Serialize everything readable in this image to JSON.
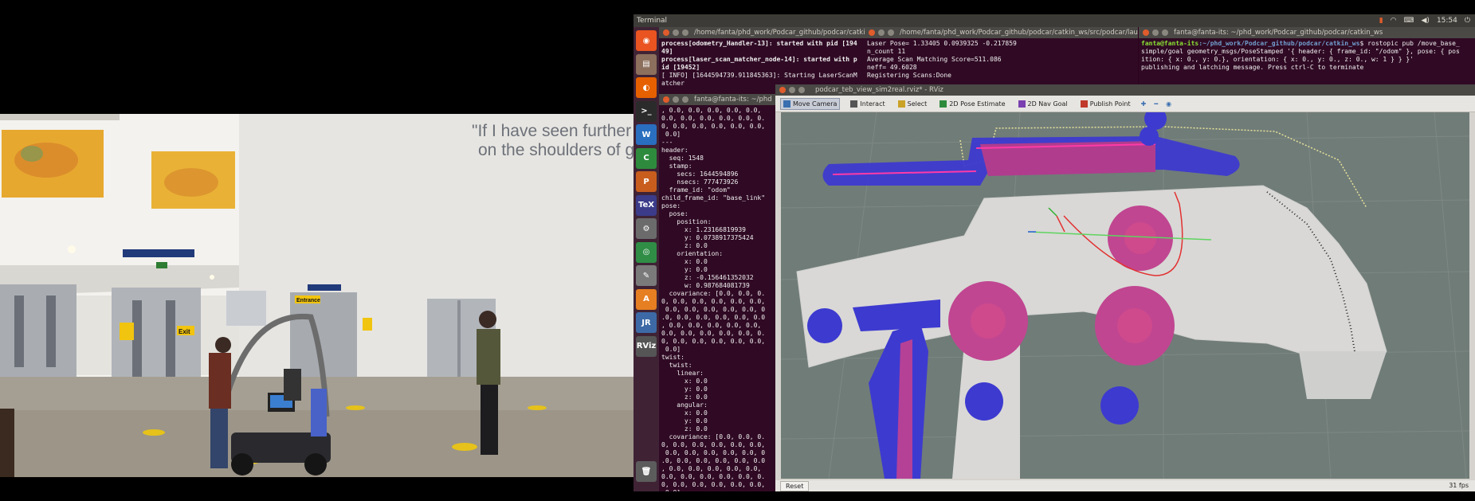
{
  "desktop": {
    "topbar_title": "Terminal",
    "clock": "15:54",
    "launcher": [
      {
        "name": "ubuntu-dash-icon",
        "glyph": "◉",
        "color": "#e95420"
      },
      {
        "name": "files-icon",
        "glyph": "▤",
        "color": "#8c6f5c"
      },
      {
        "name": "firefox-icon",
        "glyph": "◐",
        "color": "#e66000"
      },
      {
        "name": "terminal-icon",
        "glyph": ">_",
        "color": "#2b2b2b"
      },
      {
        "name": "writer-icon",
        "glyph": "W",
        "color": "#2a6ebf"
      },
      {
        "name": "calc-icon",
        "glyph": "C",
        "color": "#2e8b3d"
      },
      {
        "name": "impress-icon",
        "glyph": "P",
        "color": "#c85d1e"
      },
      {
        "name": "texmaker-icon",
        "glyph": "TeX",
        "color": "#3b3b8a"
      },
      {
        "name": "settings-icon",
        "glyph": "⚙",
        "color": "#6b6b6b"
      },
      {
        "name": "chrome-icon",
        "glyph": "◎",
        "color": "#2f8d46"
      },
      {
        "name": "editor-icon",
        "glyph": "✎",
        "color": "#7a7a7a"
      },
      {
        "name": "software-center-icon",
        "glyph": "A",
        "color": "#e67e22"
      },
      {
        "name": "jabref-icon",
        "glyph": "JR",
        "color": "#3d6aa6"
      },
      {
        "name": "rviz-icon",
        "glyph": "RViz",
        "color": "#555555"
      },
      {
        "name": "trash-icon",
        "glyph": "🗑",
        "color": "#5c5c5c"
      }
    ]
  },
  "terminals": {
    "t1": {
      "title": "/home/fanta/phd_work/Podcar_github/podcar/catkin_",
      "lines": [
        {
          "text": "process[odometry_Handler-13]: started with pid [194",
          "cls": "bold"
        },
        {
          "text": "49]",
          "cls": "bold"
        },
        {
          "text": "process[laser_scan_matcher_node-14]: started with p",
          "cls": "bold"
        },
        {
          "text": "id [19452]",
          "cls": "bold"
        },
        {
          "text": "[ INFO] [1644594739.911845363]: Starting LaserScanM",
          "cls": ""
        },
        {
          "text": "atcher",
          "cls": ""
        }
      ]
    },
    "t2": {
      "title": "/home/fanta/phd_work/Podcar_github/podcar/catkin_ws/src/podcar/laun",
      "lines": [
        "Laser Pose= 1.33405 0.0939325 -0.217859",
        "n_count 11",
        "Average Scan Matching Score=511.086",
        "neff= 49.6028",
        "Registering Scans:Done"
      ]
    },
    "t3": {
      "title": "fanta@fanta-its: ~/phd_work/Podcar_github/podcar/catkin_ws",
      "prompt_user": "fanta@fanta-its",
      "prompt_path": ":~/phd_work/Podcar_github/podcar/catkin_ws",
      "lines": [
        "$ rostopic pub /move_base_",
        "simple/goal geometry_msgs/PoseStamped '{ header: { frame_id: \"/odom\" }, pose: { pos",
        "ition: { x: 0., y: 0.}, orientation: { x: 0., y: 0., z: 0., w: 1 } } }'",
        "publishing and latching message. Press ctrl-C to terminate"
      ]
    },
    "t4": {
      "title": "fanta@fanta-its: ~/phd",
      "lines": [
        ", 0.0, 0.0, 0.0, 0.0, 0.0,",
        "0.0, 0.0, 0.0, 0.0, 0.0, 0.",
        "0, 0.0, 0.0, 0.0, 0.0, 0.0,",
        " 0.0]",
        "---",
        "header:",
        "  seq: 1548",
        "  stamp:",
        "    secs: 1644594896",
        "    nsecs: 777473926",
        "  frame_id: \"odom\"",
        "child_frame_id: \"base_link\"",
        "pose:",
        "  pose:",
        "    position:",
        "      x: 1.23166819939",
        "      y: 0.0738917375424",
        "      z: 0.0",
        "    orientation:",
        "      x: 0.0",
        "      y: 0.0",
        "      z: -0.156461352032",
        "      w: 0.987684081739",
        "  covariance: [0.0, 0.0, 0.",
        "0, 0.0, 0.0, 0.0, 0.0, 0.0,",
        " 0.0, 0.0, 0.0, 0.0, 0.0, 0",
        ".0, 0.0, 0.0, 0.0, 0.0, 0.0",
        ", 0.0, 0.0, 0.0, 0.0, 0.0,",
        "0.0, 0.0, 0.0, 0.0, 0.0, 0.",
        "0, 0.0, 0.0, 0.0, 0.0, 0.0,",
        " 0.0]",
        "twist:",
        "  twist:",
        "    linear:",
        "      x: 0.0",
        "      y: 0.0",
        "      z: 0.0",
        "    angular:",
        "      x: 0.0",
        "      y: 0.0",
        "      z: 0.0",
        "  covariance: [0.0, 0.0, 0.",
        "0, 0.0, 0.0, 0.0, 0.0, 0.0,",
        " 0.0, 0.0, 0.0, 0.0, 0.0, 0",
        ".0, 0.0, 0.0, 0.0, 0.0, 0.0",
        ", 0.0, 0.0, 0.0, 0.0, 0.0,",
        "0.0, 0.0, 0.0, 0.0, 0.0, 0.",
        "0, 0.0, 0.0, 0.0, 0.0, 0.0,",
        " 0.0]",
        "---"
      ]
    }
  },
  "rviz": {
    "title": "podcar_teb_view_sim2real.rviz* - RViz",
    "tools": [
      {
        "name": "move-camera-tool",
        "label": "Move Camera",
        "color": "#3a6fb0",
        "active": true
      },
      {
        "name": "interact-tool",
        "label": "Interact",
        "color": "#555555",
        "active": false
      },
      {
        "name": "select-tool",
        "label": "Select",
        "color": "#c9a227",
        "active": false
      },
      {
        "name": "pose-estimate-tool",
        "label": "2D Pose Estimate",
        "color": "#2e8b3d",
        "active": false
      },
      {
        "name": "nav-goal-tool",
        "label": "2D Nav Goal",
        "color": "#7a3fb0",
        "active": false
      },
      {
        "name": "publish-point-tool",
        "label": "Publish Point",
        "color": "#c0392b",
        "active": false
      }
    ],
    "reset_label": "Reset",
    "fps": "31 fps"
  },
  "video": {
    "wall_quote_line1": "\"If I have seen further o",
    "wall_quote_line2": "on the shoulders of g",
    "sign_exit": "Exit",
    "sign_entrance": "Entrance"
  }
}
